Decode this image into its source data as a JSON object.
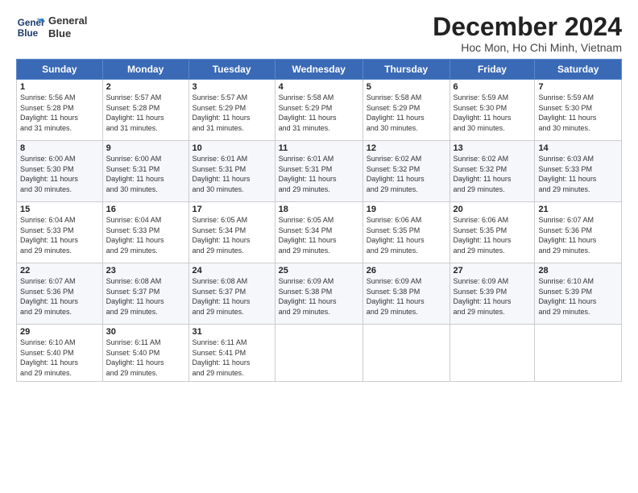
{
  "header": {
    "logo_line1": "General",
    "logo_line2": "Blue",
    "month_title": "December 2024",
    "location": "Hoc Mon, Ho Chi Minh, Vietnam"
  },
  "weekdays": [
    "Sunday",
    "Monday",
    "Tuesday",
    "Wednesday",
    "Thursday",
    "Friday",
    "Saturday"
  ],
  "weeks": [
    [
      {
        "day": "1",
        "detail": "Sunrise: 5:56 AM\nSunset: 5:28 PM\nDaylight: 11 hours\nand 31 minutes."
      },
      {
        "day": "2",
        "detail": "Sunrise: 5:57 AM\nSunset: 5:28 PM\nDaylight: 11 hours\nand 31 minutes."
      },
      {
        "day": "3",
        "detail": "Sunrise: 5:57 AM\nSunset: 5:29 PM\nDaylight: 11 hours\nand 31 minutes."
      },
      {
        "day": "4",
        "detail": "Sunrise: 5:58 AM\nSunset: 5:29 PM\nDaylight: 11 hours\nand 31 minutes."
      },
      {
        "day": "5",
        "detail": "Sunrise: 5:58 AM\nSunset: 5:29 PM\nDaylight: 11 hours\nand 30 minutes."
      },
      {
        "day": "6",
        "detail": "Sunrise: 5:59 AM\nSunset: 5:30 PM\nDaylight: 11 hours\nand 30 minutes."
      },
      {
        "day": "7",
        "detail": "Sunrise: 5:59 AM\nSunset: 5:30 PM\nDaylight: 11 hours\nand 30 minutes."
      }
    ],
    [
      {
        "day": "8",
        "detail": "Sunrise: 6:00 AM\nSunset: 5:30 PM\nDaylight: 11 hours\nand 30 minutes."
      },
      {
        "day": "9",
        "detail": "Sunrise: 6:00 AM\nSunset: 5:31 PM\nDaylight: 11 hours\nand 30 minutes."
      },
      {
        "day": "10",
        "detail": "Sunrise: 6:01 AM\nSunset: 5:31 PM\nDaylight: 11 hours\nand 30 minutes."
      },
      {
        "day": "11",
        "detail": "Sunrise: 6:01 AM\nSunset: 5:31 PM\nDaylight: 11 hours\nand 29 minutes."
      },
      {
        "day": "12",
        "detail": "Sunrise: 6:02 AM\nSunset: 5:32 PM\nDaylight: 11 hours\nand 29 minutes."
      },
      {
        "day": "13",
        "detail": "Sunrise: 6:02 AM\nSunset: 5:32 PM\nDaylight: 11 hours\nand 29 minutes."
      },
      {
        "day": "14",
        "detail": "Sunrise: 6:03 AM\nSunset: 5:33 PM\nDaylight: 11 hours\nand 29 minutes."
      }
    ],
    [
      {
        "day": "15",
        "detail": "Sunrise: 6:04 AM\nSunset: 5:33 PM\nDaylight: 11 hours\nand 29 minutes."
      },
      {
        "day": "16",
        "detail": "Sunrise: 6:04 AM\nSunset: 5:33 PM\nDaylight: 11 hours\nand 29 minutes."
      },
      {
        "day": "17",
        "detail": "Sunrise: 6:05 AM\nSunset: 5:34 PM\nDaylight: 11 hours\nand 29 minutes."
      },
      {
        "day": "18",
        "detail": "Sunrise: 6:05 AM\nSunset: 5:34 PM\nDaylight: 11 hours\nand 29 minutes."
      },
      {
        "day": "19",
        "detail": "Sunrise: 6:06 AM\nSunset: 5:35 PM\nDaylight: 11 hours\nand 29 minutes."
      },
      {
        "day": "20",
        "detail": "Sunrise: 6:06 AM\nSunset: 5:35 PM\nDaylight: 11 hours\nand 29 minutes."
      },
      {
        "day": "21",
        "detail": "Sunrise: 6:07 AM\nSunset: 5:36 PM\nDaylight: 11 hours\nand 29 minutes."
      }
    ],
    [
      {
        "day": "22",
        "detail": "Sunrise: 6:07 AM\nSunset: 5:36 PM\nDaylight: 11 hours\nand 29 minutes."
      },
      {
        "day": "23",
        "detail": "Sunrise: 6:08 AM\nSunset: 5:37 PM\nDaylight: 11 hours\nand 29 minutes."
      },
      {
        "day": "24",
        "detail": "Sunrise: 6:08 AM\nSunset: 5:37 PM\nDaylight: 11 hours\nand 29 minutes."
      },
      {
        "day": "25",
        "detail": "Sunrise: 6:09 AM\nSunset: 5:38 PM\nDaylight: 11 hours\nand 29 minutes."
      },
      {
        "day": "26",
        "detail": "Sunrise: 6:09 AM\nSunset: 5:38 PM\nDaylight: 11 hours\nand 29 minutes."
      },
      {
        "day": "27",
        "detail": "Sunrise: 6:09 AM\nSunset: 5:39 PM\nDaylight: 11 hours\nand 29 minutes."
      },
      {
        "day": "28",
        "detail": "Sunrise: 6:10 AM\nSunset: 5:39 PM\nDaylight: 11 hours\nand 29 minutes."
      }
    ],
    [
      {
        "day": "29",
        "detail": "Sunrise: 6:10 AM\nSunset: 5:40 PM\nDaylight: 11 hours\nand 29 minutes."
      },
      {
        "day": "30",
        "detail": "Sunrise: 6:11 AM\nSunset: 5:40 PM\nDaylight: 11 hours\nand 29 minutes."
      },
      {
        "day": "31",
        "detail": "Sunrise: 6:11 AM\nSunset: 5:41 PM\nDaylight: 11 hours\nand 29 minutes."
      },
      {
        "day": "",
        "detail": ""
      },
      {
        "day": "",
        "detail": ""
      },
      {
        "day": "",
        "detail": ""
      },
      {
        "day": "",
        "detail": ""
      }
    ]
  ]
}
